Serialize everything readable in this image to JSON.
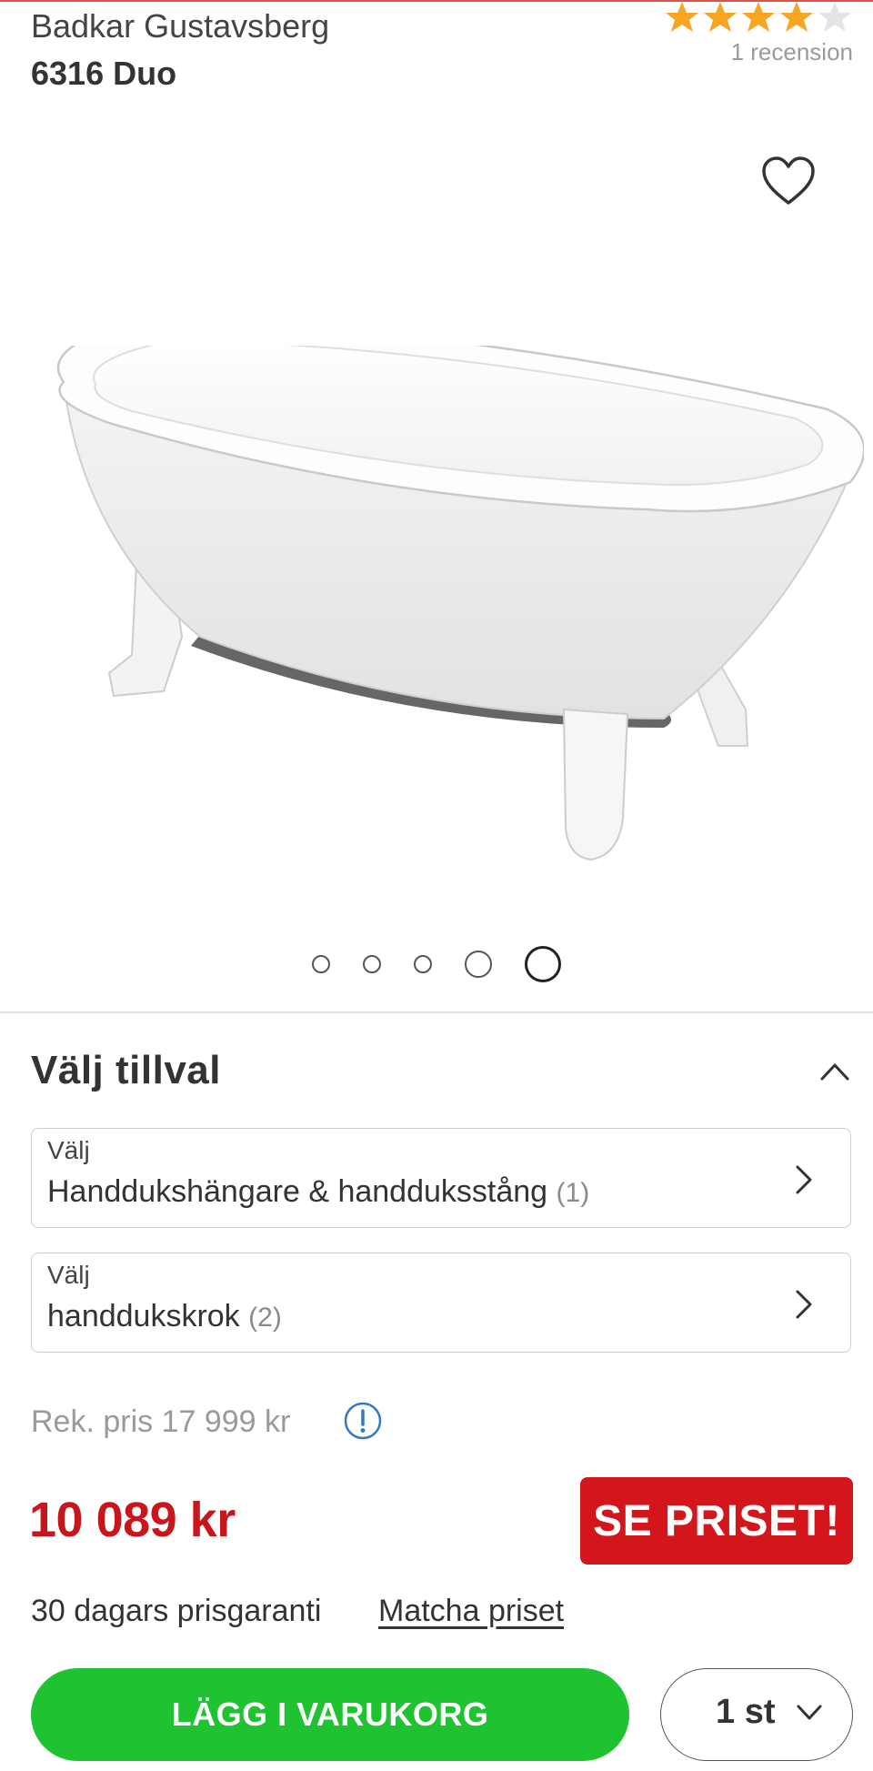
{
  "product": {
    "brand": "Badkar Gustavsberg",
    "model": "6316 Duo",
    "rating": 4,
    "rating_max": 5,
    "review_count": "1 recension",
    "star_color": "#f5a623"
  },
  "gallery": {
    "image_count": 5,
    "active_index": 5
  },
  "options": {
    "title": "Välj tillval",
    "items": [
      {
        "label": "Välj",
        "value": "Handdukshängare & handduksstång",
        "count": "(1)"
      },
      {
        "label": "Välj",
        "value": "handdukskrok",
        "count": "(2)"
      }
    ]
  },
  "pricing": {
    "recommended": "Rek. pris 17 999 kr",
    "price": "10 089 kr",
    "badge": "SE PRISET!",
    "guarantee": "30 dagars prisgaranti",
    "match": "Matcha priset",
    "price_color": "#c8161d"
  },
  "cart": {
    "add_label": "LÄGG I VARUKORG",
    "quantity": "1 st",
    "button_color": "#1fc231"
  }
}
